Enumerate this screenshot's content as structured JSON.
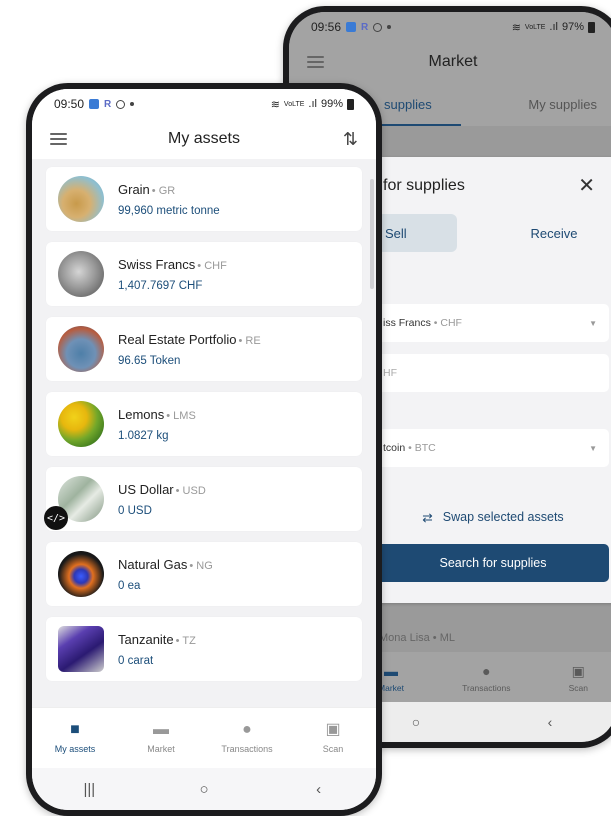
{
  "back_phone": {
    "status": {
      "time": "09:56",
      "battery": "97%",
      "network": "VoLTE"
    },
    "title": "Market",
    "tabs": [
      {
        "label": "supplies",
        "active": true
      },
      {
        "label": "My supplies",
        "active": false
      }
    ],
    "sheet": {
      "title": "for supplies",
      "segment_sell": "Sell",
      "segment_receive": "Receive",
      "from_asset": {
        "name": "iss Francs",
        "sym": "• CHF"
      },
      "amount_placeholder": "HF",
      "to_asset": {
        "name": "tcoin",
        "sym": "• BTC"
      },
      "swap_label": "Swap selected assets",
      "search_label": "Search for supplies"
    },
    "peek_text": "Mona Lisa • ML",
    "nav": [
      {
        "label": "Market",
        "icon": "store-icon",
        "active": true
      },
      {
        "label": "Transactions",
        "icon": "clock-icon",
        "active": false
      },
      {
        "label": "Scan",
        "icon": "qr-icon",
        "active": false
      }
    ]
  },
  "front_phone": {
    "status": {
      "time": "09:50",
      "battery": "99%",
      "network": "VoLTE"
    },
    "title": "My assets",
    "assets": [
      {
        "name": "Grain",
        "symbol": "• GR",
        "balance": "99,960 metric tonne"
      },
      {
        "name": "Swiss Francs",
        "symbol": "• CHF",
        "balance": "1,407.7697 CHF"
      },
      {
        "name": "Real Estate Portfolio",
        "symbol": "• RE",
        "balance": "96.65 Token"
      },
      {
        "name": "Lemons",
        "symbol": "• LMS",
        "balance": "1.0827 kg"
      },
      {
        "name": "US Dollar",
        "symbol": "• USD",
        "balance": "0 USD"
      },
      {
        "name": "Natural Gas",
        "symbol": "• NG",
        "balance": "0 ea"
      },
      {
        "name": "Tanzanite",
        "symbol": "• TZ",
        "balance": "0 carat"
      }
    ],
    "nav": [
      {
        "label": "My assets",
        "icon": "briefcase-icon",
        "active": true
      },
      {
        "label": "Market",
        "icon": "store-icon",
        "active": false
      },
      {
        "label": "Transactions",
        "icon": "clock-icon",
        "active": false
      },
      {
        "label": "Scan",
        "icon": "qr-icon",
        "active": false
      }
    ]
  },
  "colors": {
    "primary": "#1e4a73",
    "balance_text": "#1c4e7a"
  }
}
